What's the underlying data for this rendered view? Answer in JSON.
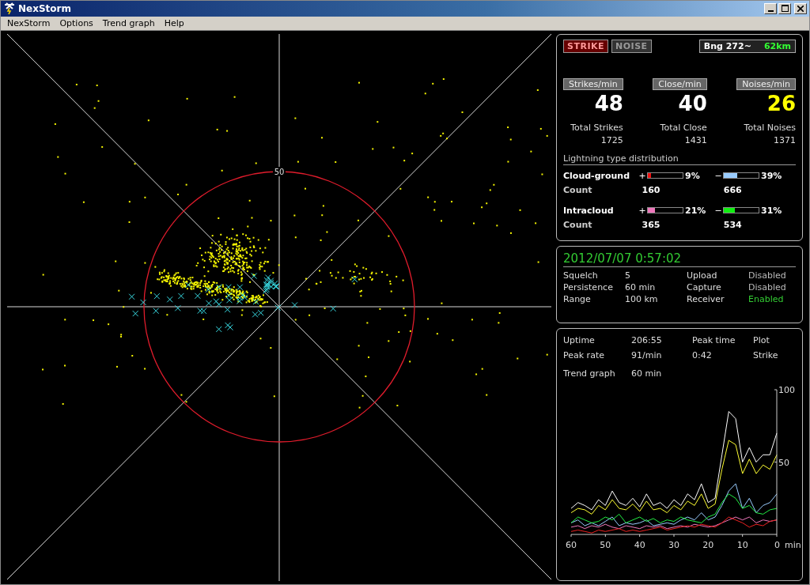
{
  "window": {
    "title": "NexStorm"
  },
  "menu": [
    {
      "label": "NexStorm"
    },
    {
      "label": "Options"
    },
    {
      "label": "Trend graph"
    },
    {
      "label": "Help"
    }
  ],
  "map": {
    "range_label": "50"
  },
  "strike_panel": {
    "modes": [
      {
        "label": "STRIKE",
        "selected": true
      },
      {
        "label": "NOISE",
        "selected": false
      }
    ],
    "bearing": {
      "label": "Bng 272~",
      "distance": "62km"
    },
    "rates": [
      {
        "label": "Strikes/min",
        "value": "48",
        "total_label": "Total Strikes",
        "total": "1725",
        "color": "#ffffff"
      },
      {
        "label": "Close/min",
        "value": "40",
        "total_label": "Total Close",
        "total": "1431",
        "color": "#ffffff"
      },
      {
        "label": "Noises/min",
        "value": "26",
        "total_label": "Total Noises",
        "total": "1371",
        "color": "#ffff00"
      }
    ],
    "distribution": {
      "title": "Lightning type distribution",
      "rows": [
        {
          "name": "Cloud-ground",
          "count_label": "Count",
          "bars": [
            {
              "sign": "+",
              "level": 0.09,
              "reading": "9%",
              "count": "160",
              "color": "#ee1111"
            },
            {
              "sign": "−",
              "level": 0.39,
              "reading": "39%",
              "count": "666",
              "color": "#99ccff"
            }
          ]
        },
        {
          "name": "Intracloud",
          "count_label": "Count",
          "bars": [
            {
              "sign": "+",
              "level": 0.21,
              "reading": "21%",
              "count": "365",
              "color": "#ee77bb"
            },
            {
              "sign": "−",
              "level": 0.31,
              "reading": "31%",
              "count": "534",
              "color": "#11ee11"
            }
          ]
        }
      ]
    }
  },
  "status_panel": {
    "datetime": "2012/07/07 0:57:02",
    "settings": [
      {
        "label": "Squelch",
        "value": "5"
      },
      {
        "label": "Persistence",
        "value": "60 min"
      },
      {
        "label": "Range",
        "value": "100 km"
      }
    ],
    "services": [
      {
        "label": "Upload",
        "value": "Disabled",
        "enabled": false
      },
      {
        "label": "Capture",
        "value": "Disabled",
        "enabled": false
      },
      {
        "label": "Receiver",
        "value": "Enabled",
        "enabled": true
      }
    ]
  },
  "trend_panel": {
    "rows": [
      {
        "cells": [
          "Uptime",
          "206:55",
          "Peak time",
          "Plot"
        ]
      },
      {
        "cells": [
          "Peak rate",
          "91/min",
          "0:42",
          "Strike"
        ]
      }
    ],
    "trend": {
      "label": "Trend graph",
      "value": "60 min"
    },
    "chart_data": {
      "type": "line",
      "xlabel": "min",
      "x": [
        60,
        58,
        56,
        54,
        52,
        50,
        48,
        46,
        44,
        42,
        40,
        38,
        36,
        34,
        32,
        30,
        28,
        26,
        24,
        22,
        20,
        18,
        16,
        14,
        12,
        10,
        8,
        6,
        4,
        2,
        0
      ],
      "xlim": [
        60,
        0
      ],
      "ylim": [
        0,
        100
      ],
      "xticks": [
        60,
        50,
        40,
        30,
        20,
        10,
        0
      ],
      "yticks": [
        50,
        100
      ],
      "series": [
        {
          "color": "#ffffff",
          "values": [
            18,
            22,
            20,
            17,
            24,
            20,
            30,
            22,
            20,
            25,
            19,
            28,
            20,
            22,
            18,
            24,
            20,
            28,
            24,
            35,
            22,
            25,
            55,
            85,
            80,
            50,
            60,
            50,
            55,
            55,
            70
          ]
        },
        {
          "color": "#ffff33",
          "values": [
            15,
            18,
            17,
            14,
            20,
            17,
            24,
            18,
            17,
            21,
            16,
            23,
            17,
            18,
            15,
            20,
            17,
            23,
            20,
            28,
            18,
            21,
            45,
            65,
            62,
            42,
            52,
            42,
            48,
            45,
            55
          ]
        },
        {
          "color": "#99ccff",
          "values": [
            8,
            10,
            6,
            8,
            6,
            9,
            12,
            6,
            8,
            7,
            8,
            10,
            6,
            7,
            8,
            7,
            10,
            12,
            10,
            15,
            10,
            12,
            20,
            30,
            35,
            18,
            25,
            15,
            20,
            22,
            28
          ]
        },
        {
          "color": "#22ee44",
          "values": [
            8,
            12,
            10,
            8,
            9,
            12,
            10,
            14,
            8,
            10,
            12,
            9,
            11,
            8,
            10,
            9,
            12,
            10,
            9,
            8,
            12,
            14,
            22,
            28,
            25,
            18,
            20,
            15,
            14,
            17,
            18
          ]
        },
        {
          "color": "#ee77bb",
          "values": [
            5,
            6,
            4,
            6,
            5,
            7,
            5,
            4,
            6,
            5,
            4,
            6,
            5,
            6,
            4,
            5,
            6,
            5,
            7,
            6,
            5,
            6,
            8,
            10,
            12,
            10,
            12,
            8,
            10,
            9,
            10
          ]
        },
        {
          "color": "#ee2222",
          "values": [
            2,
            3,
            2,
            1,
            3,
            2,
            3,
            4,
            2,
            3,
            2,
            3,
            4,
            5,
            3,
            4,
            5,
            6,
            5,
            7,
            6,
            5,
            8,
            12,
            10,
            8,
            5,
            7,
            6,
            9,
            10
          ]
        }
      ]
    }
  }
}
